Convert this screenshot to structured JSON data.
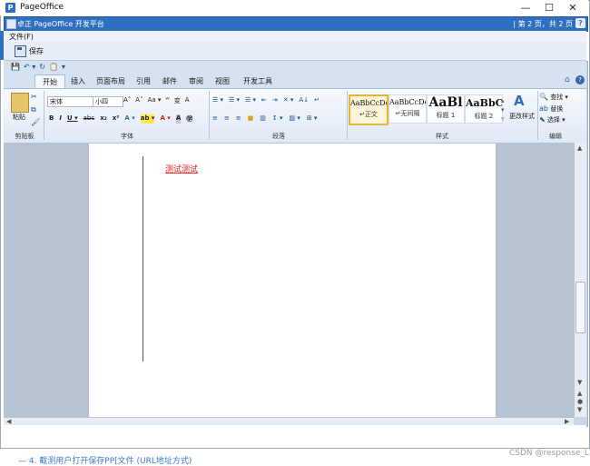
{
  "window": {
    "title": "PageOffice",
    "app_icon": "P",
    "minimize": "—",
    "maximize": "☐",
    "close": "✕"
  },
  "pobar": {
    "title": "卓正 PageOffice 开发平台",
    "page_info": "| 第 2 页，共 2 页",
    "help": "?"
  },
  "menu": {
    "file": "文件(F)"
  },
  "toolbar": {
    "save_label": "保存"
  },
  "qat": {
    "items": [
      "💾",
      "↶ ▾",
      "↻",
      "📋",
      "▾"
    ]
  },
  "tabs": [
    "开始",
    "插入",
    "页面布局",
    "引用",
    "邮件",
    "审阅",
    "视图",
    "开发工具"
  ],
  "ribbon": {
    "clipboard": {
      "paste": "粘贴",
      "label": "剪贴板"
    },
    "font": {
      "name": "宋体",
      "size": "小四",
      "label": "字体",
      "row1": [
        "A˄",
        "A˅",
        "Aa ▾",
        "ᵂ",
        "变",
        "A"
      ],
      "row2": [
        "B",
        "I",
        "U ▾",
        "abc",
        "x₂",
        "x²",
        "A ▾",
        "ab ▾",
        "A ▾",
        "A",
        "㊫"
      ]
    },
    "paragraph": {
      "label": "段落",
      "row1": [
        "☰ ▾",
        "☰ ▾",
        "☰ ▾",
        "⇤",
        "⇥",
        "✕ ▾",
        "A↓",
        "↵"
      ],
      "row2": [
        "≡",
        "≡",
        "≡",
        "■",
        "▥",
        "↕ ▾",
        "▨ ▾",
        "⊞ ▾"
      ]
    },
    "styles": {
      "label": "样式",
      "change_label": "更改样式",
      "items": [
        {
          "sample": "AaBbCcDc",
          "name": "↵正文"
        },
        {
          "sample": "AaBbCcDc",
          "name": "↵无间隔"
        },
        {
          "sample": "AaBl",
          "name": "标题 1"
        },
        {
          "sample": "AaBbC",
          "name": "标题 2"
        }
      ]
    },
    "editing": {
      "label": "编辑",
      "find": "查找 ▾",
      "replace": "替换",
      "select": "选择 ▾"
    }
  },
  "document": {
    "text": "测试测试"
  },
  "footer": {
    "watermark": "CSDN @response_L",
    "background_text": "—  4. 截测用户打开保存PP[文件 (URL地址方式)"
  }
}
